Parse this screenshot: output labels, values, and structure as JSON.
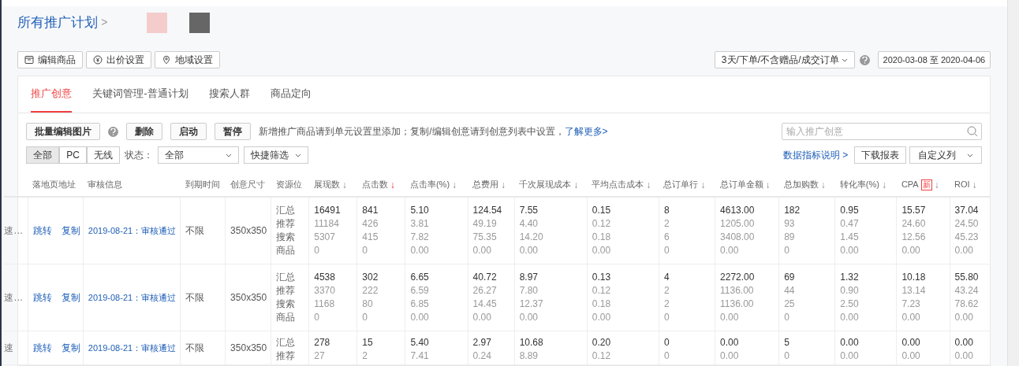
{
  "breadcrumb": {
    "root": "所有推广计划",
    "separator": ">"
  },
  "toolbar": [
    {
      "kind": "box",
      "label": "编辑商品"
    },
    {
      "kind": "yen",
      "label": "出价设置"
    },
    {
      "kind": "pin",
      "label": "地域设置"
    }
  ],
  "attribution": {
    "label": "3天/下单/不含赠品/成交订单",
    "help": true
  },
  "date_range": "2020-03-08 至 2020-04-06",
  "tabs": [
    {
      "label": "推广创意",
      "selected": true
    },
    {
      "label": "关键词管理-普通计划",
      "selected": false
    },
    {
      "label": "搜索人群",
      "selected": false
    },
    {
      "label": "商品定向",
      "selected": false
    }
  ],
  "actions": [
    {
      "label": "批量编辑图片",
      "help": true
    },
    {
      "label": "删除"
    },
    {
      "label": "启动"
    },
    {
      "label": "暂停"
    }
  ],
  "notice": "新增推广商品请到单元设置里添加；复制/编辑创意请到创意列表中设置，",
  "notice_link": "了解更多>",
  "search": {
    "placeholder": "输入推广创意"
  },
  "device_filter": [
    {
      "label": "全部",
      "selected": true
    },
    {
      "label": "PC",
      "selected": false
    },
    {
      "label": "无线",
      "selected": false
    }
  ],
  "status_label": "状态：",
  "status_select": "全部",
  "quick_filter": "快捷筛选",
  "metrics_link": "数据指标说明 >",
  "download_button": "下载报表",
  "custom_columns": "自定义列",
  "table": {
    "columns": [
      {},
      {
        "label": "落地页地址"
      },
      {
        "label": "审核信息"
      },
      {
        "label": "到期时间"
      },
      {
        "label": "创意尺寸"
      },
      {
        "label": "资源位"
      },
      {
        "label": "展现数",
        "sort": "↓",
        "sort_active": false
      },
      {
        "label": "点击数",
        "sort": "↓",
        "sort_active": true
      },
      {
        "label": "点击率(%)",
        "sort": "↓",
        "sort_active": false
      },
      {
        "label": "总费用",
        "sort": "↓",
        "sort_active": false
      },
      {
        "label": "千次展现成本",
        "sort": "↓",
        "sort_active": false
      },
      {
        "label": "平均点击成本",
        "sort": "↓",
        "sort_active": false
      },
      {
        "label": "总订单行",
        "sort": "↓",
        "sort_active": false
      },
      {
        "label": "总订单金额",
        "sort": "↓",
        "sort_active": false
      },
      {
        "label": "总加购数",
        "sort": "↓",
        "sort_active": false
      },
      {
        "label": "转化率(%)",
        "sort": "↓",
        "sort_active": false
      },
      {
        "label": "CPA",
        "badge": "新",
        "sort": "↓",
        "sort_active": false
      },
      {
        "label": "ROI",
        "sort": "↓",
        "sort_active": false
      }
    ],
    "rows": [
      {
        "column_1": "速…",
        "links": [
          "跳转",
          "复制"
        ],
        "review": "2019-08-21：审核通过",
        "expiry": "不限",
        "size": "350x350",
        "lines": [
          {
            "label": "汇总",
            "values": [
              "16491",
              "841",
              "5.10",
              "124.54",
              "7.55",
              "0.15",
              "8",
              "4613.00",
              "182",
              "0.95",
              "15.57",
              "37.04"
            ]
          },
          {
            "label": "推荐",
            "values": [
              "11184",
              "426",
              "3.81",
              "49.19",
              "4.40",
              "0.12",
              "2",
              "1205.00",
              "93",
              "0.47",
              "24.60",
              "24.50"
            ]
          },
          {
            "label": "搜索",
            "values": [
              "5307",
              "415",
              "7.82",
              "75.35",
              "14.20",
              "0.18",
              "6",
              "3408.00",
              "89",
              "1.45",
              "12.56",
              "45.23"
            ]
          },
          {
            "label": "商品",
            "values": [
              "0",
              "0",
              "0.00",
              "0.00",
              "0.00",
              "0.00",
              "0",
              "0.00",
              "0",
              "0.00",
              "0.00",
              "0.00"
            ]
          }
        ]
      },
      {
        "column_1": "速…",
        "links": [
          "跳转",
          "复制"
        ],
        "review": "2019-08-21：审核通过",
        "expiry": "不限",
        "size": "350x350",
        "lines": [
          {
            "label": "汇总",
            "values": [
              "4538",
              "302",
              "6.65",
              "40.72",
              "8.97",
              "0.13",
              "4",
              "2272.00",
              "69",
              "1.32",
              "10.18",
              "55.80"
            ]
          },
          {
            "label": "推荐",
            "values": [
              "3370",
              "222",
              "6.59",
              "26.27",
              "7.80",
              "0.12",
              "2",
              "1136.00",
              "44",
              "0.90",
              "13.14",
              "43.24"
            ]
          },
          {
            "label": "搜索",
            "values": [
              "1168",
              "80",
              "6.85",
              "14.45",
              "12.37",
              "0.18",
              "2",
              "1136.00",
              "25",
              "2.50",
              "7.23",
              "78.62"
            ]
          },
          {
            "label": "商品",
            "values": [
              "0",
              "0",
              "0.00",
              "0.00",
              "0.00",
              "0.00",
              "0",
              "0.00",
              "0",
              "0.00",
              "0.00",
              "0.00"
            ]
          }
        ]
      },
      {
        "column_1": "速",
        "links": [
          "跳转",
          "复制"
        ],
        "review": "2019-08-21：审核通过",
        "expiry": "不限",
        "size": "350x350",
        "lines": [
          {
            "label": "汇总",
            "values": [
              "278",
              "15",
              "5.40",
              "2.97",
              "10.68",
              "0.20",
              "0",
              "0.00",
              "5",
              "0.00",
              "0.00",
              "0.00"
            ]
          },
          {
            "label": "推荐",
            "values": [
              "27",
              "2",
              "7.41",
              "0.24",
              "8.89",
              "0.12",
              "0",
              "0.00",
              "0",
              "0.00",
              "0.00",
              "0.00"
            ]
          }
        ]
      }
    ]
  }
}
